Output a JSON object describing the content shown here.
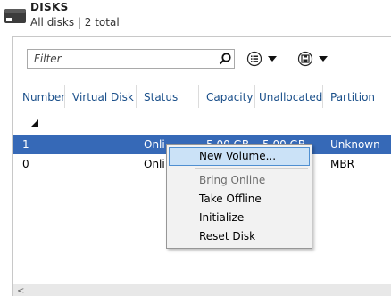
{
  "header": {
    "title": "DISKS",
    "subtitle": "All disks | 2 total"
  },
  "filter": {
    "placeholder": "Filter",
    "value": ""
  },
  "toolbar": {
    "list_icon": "list-icon",
    "save_icon": "save-icon"
  },
  "table": {
    "columns": [
      "Number",
      "Virtual Disk",
      "Status",
      "Capacity",
      "Unallocated",
      "Partition"
    ],
    "rows": [
      {
        "number": "1",
        "virtual_disk": "",
        "status": "Onli",
        "capacity": "5.00 GB",
        "unallocated": "5.00 GB",
        "partition": "Unknown",
        "selected": true
      },
      {
        "number": "0",
        "virtual_disk": "",
        "status": "Onli",
        "capacity": "",
        "unallocated": "",
        "partition": "MBR",
        "selected": false
      }
    ]
  },
  "context_menu": {
    "items": [
      {
        "label": "New Volume...",
        "highlighted": true,
        "enabled": true
      },
      {
        "label": "Bring Online",
        "highlighted": false,
        "enabled": false
      },
      {
        "label": "Take Offline",
        "highlighted": false,
        "enabled": true
      },
      {
        "label": "Initialize",
        "highlighted": false,
        "enabled": true
      },
      {
        "label": "Reset Disk",
        "highlighted": false,
        "enabled": true
      }
    ]
  },
  "scrollbar": {
    "left_arrow": "<"
  },
  "colors": {
    "selection": "#3669b7",
    "header_text": "#1a4f8a",
    "menu_highlight": "#cbe2f7",
    "menu_highlight_border": "#4f8fd1"
  }
}
